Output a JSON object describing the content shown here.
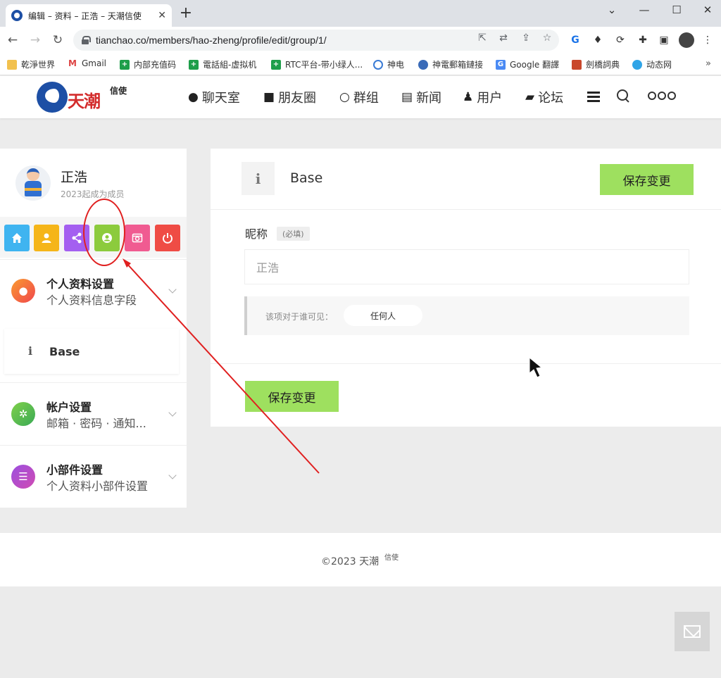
{
  "browser": {
    "tab_title": "编辑 – 资料 – 正浩 – 天潮信使",
    "url": "tianchao.co/members/hao-zheng/profile/edit/group/1/",
    "bookmarks": [
      "乾淨世界",
      "Gmail",
      "内部充值码",
      "電話組-虚拟机",
      "RTC平台-带小绿人...",
      "神电",
      "神電郵箱鏈接",
      "Google 翻譯",
      "劍橋詞典",
      "动态网"
    ]
  },
  "header": {
    "logo_text": "天潮",
    "logo_sup": "信使",
    "nav": [
      {
        "label": "聊天室",
        "icon": "chat-icon"
      },
      {
        "label": "朋友圈",
        "icon": "camera-icon"
      },
      {
        "label": "群组",
        "icon": "comments-icon"
      },
      {
        "label": "新闻",
        "icon": "document-icon"
      },
      {
        "label": "用户",
        "icon": "user-plus-icon"
      },
      {
        "label": "论坛",
        "icon": "book-icon"
      }
    ]
  },
  "sidebar": {
    "user_name": "正浩",
    "member_since": "2023起成为成员",
    "quick_buttons": [
      {
        "name": "home",
        "color": "#3fb4f0"
      },
      {
        "name": "profile",
        "color": "#f5b519"
      },
      {
        "name": "share",
        "color": "#a45ff0"
      },
      {
        "name": "account",
        "color": "#8ccb3d"
      },
      {
        "name": "photo",
        "color": "#f05b91"
      },
      {
        "name": "logout",
        "color": "#ef4c45"
      }
    ],
    "sections": [
      {
        "title": "个人资料设置",
        "subtitle": "个人资料信息字段"
      },
      {
        "title": "帐户设置",
        "subtitle": "邮箱 · 密码 · 通知..."
      },
      {
        "title": "小部件设置",
        "subtitle": "个人资料小部件设置"
      }
    ],
    "base_item": {
      "icon": "i",
      "label": "Base"
    }
  },
  "main": {
    "info_icon": "i",
    "title": "Base",
    "save_label": "保存变更",
    "field_label": "昵称",
    "required_tag": "(必填)",
    "name_value": "正浩",
    "visibility_label": "该项对于谁可见：",
    "visibility_value": "任何人"
  },
  "footer": {
    "copyright": "©2023 天潮",
    "copyright_sup": "信使"
  },
  "colors": {
    "accent_green": "#9ee05f",
    "annotation_red": "#e02020"
  }
}
